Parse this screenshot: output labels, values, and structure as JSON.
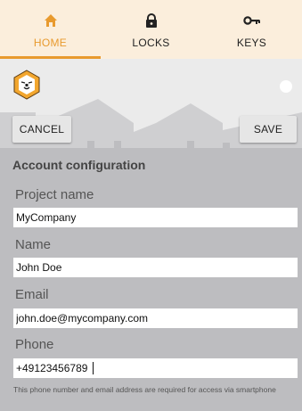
{
  "tabs": [
    {
      "label": "HOME",
      "icon": "home-icon",
      "active": true
    },
    {
      "label": "LOCKS",
      "icon": "lock-icon",
      "active": false
    },
    {
      "label": "KEYS",
      "icon": "key-icon",
      "active": false
    }
  ],
  "colors": {
    "accent": "#e89a2e",
    "tabbar_bg": "#fbeedc",
    "form_bg": "#bdbdc0"
  },
  "banner": {
    "logo_icon": "lion-logo-icon",
    "cancel_label": "CANCEL",
    "save_label": "SAVE"
  },
  "form": {
    "title": "Account configuration",
    "project_name": {
      "label": "Project name",
      "value": "MyCompany"
    },
    "name": {
      "label": "Name",
      "value": "John Doe"
    },
    "email": {
      "label": "Email",
      "value": "john.doe@mycompany.com"
    },
    "phone": {
      "label": "Phone",
      "value": "+49123456789"
    },
    "help_text": "This phone number and email address are required for access via smartphone"
  }
}
